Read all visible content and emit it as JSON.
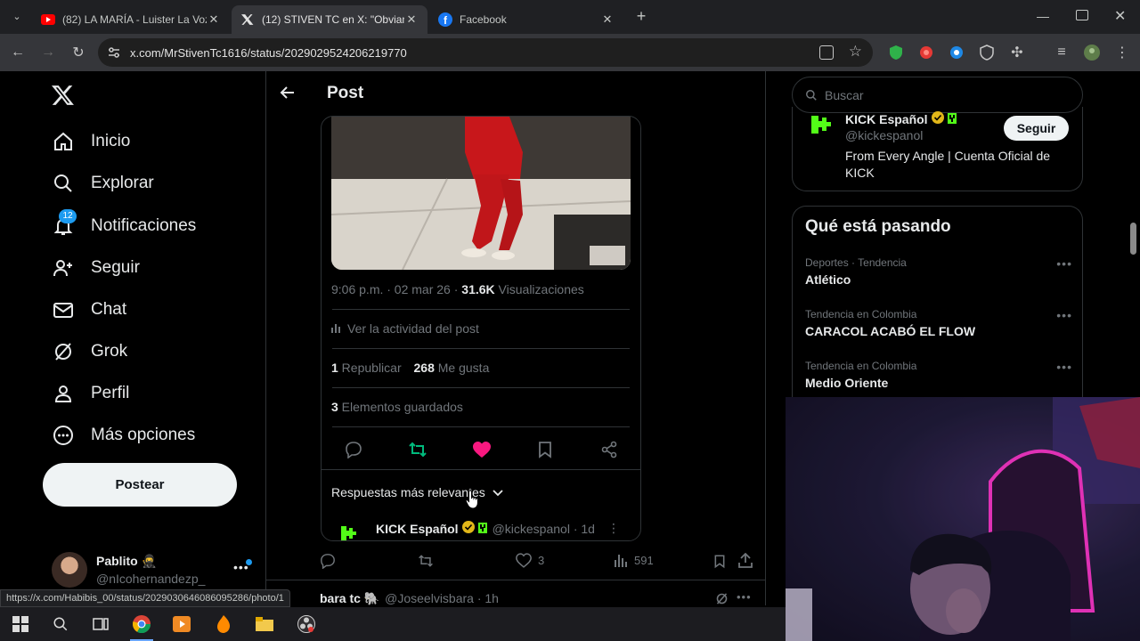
{
  "browser": {
    "tabs": [
      {
        "title": "(82) LA MARÍA - Luister La Voz",
        "favicon": "youtube-icon",
        "active": false
      },
      {
        "title": "(12) STIVEN TC en X: \"Obviame",
        "favicon": "x-logo-icon",
        "active": true
      },
      {
        "title": "Facebook",
        "favicon": "facebook-icon",
        "active": false
      }
    ],
    "new_tab": "+",
    "url": "x.com/MrStivenTc1616/status/2029029524206219770",
    "status_url": "https://x.com/Habibis_00/status/2029030646086095286/photo/1"
  },
  "sidebar": {
    "items": [
      {
        "label": "Inicio",
        "icon": "home-icon"
      },
      {
        "label": "Explorar",
        "icon": "search-icon"
      },
      {
        "label": "Notificaciones",
        "icon": "bell-icon",
        "badge": "12"
      },
      {
        "label": "Seguir",
        "icon": "person-add-icon"
      },
      {
        "label": "Chat",
        "icon": "mail-icon"
      },
      {
        "label": "Grok",
        "icon": "grok-icon"
      },
      {
        "label": "Perfil",
        "icon": "person-icon"
      },
      {
        "label": "Más opciones",
        "icon": "more-circle-icon"
      }
    ],
    "post_button": "Postear",
    "account": {
      "name": "Pablito",
      "emoji": "🥷",
      "handle": "@nIcohernandezp_"
    }
  },
  "main": {
    "header_title": "Post",
    "quoted": {
      "timestamp": "9:06 p.m. · 02 mar 26 · ",
      "views_count": "31.6K",
      "views_label": " Visualizaciones",
      "activity_link": "Ver la actividad del post",
      "reposts_count": "1",
      "reposts_label": " Republicar",
      "likes_count": "268",
      "likes_label": " Me gusta",
      "bookmarks_count": "3",
      "bookmarks_label": " Elementos guardados",
      "replies_sort": "Respuestas más relevantes",
      "reply_author": "KICK Español",
      "reply_handle": "@kickespanol · 1d"
    },
    "outer_actions": {
      "replies": "",
      "reposts": "",
      "likes": "3",
      "views": "591"
    },
    "next_tweet": {
      "author": "bara tc",
      "emoji": "🐘",
      "handle": "@Joseelvisbara · 1h"
    }
  },
  "right": {
    "search_placeholder": "Buscar",
    "who_to_follow": {
      "name": "KICK Español",
      "handle": "@kickespanol",
      "bio": "From Every Angle | Cuenta Oficial de KICK",
      "follow_button": "Seguir"
    },
    "trends_title": "Qué está pasando",
    "trends": [
      {
        "category": "Deportes · Tendencia",
        "name": "Atlético"
      },
      {
        "category": "Tendencia en Colombia",
        "name": "CARACOL ACABÓ EL FLOW"
      },
      {
        "category": "Tendencia en Colombia",
        "name": "Medio Oriente"
      }
    ]
  },
  "colors": {
    "like_pink": "#f91880",
    "repost_green": "#00ba7c",
    "kick_green": "#53fc18",
    "verified_gold": "#e2b719"
  }
}
